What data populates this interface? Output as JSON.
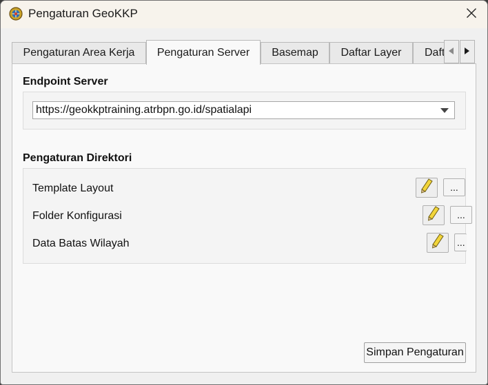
{
  "window": {
    "title": "Pengaturan GeoKKP"
  },
  "tabs": [
    {
      "label": "Pengaturan Area Kerja",
      "active": false
    },
    {
      "label": "Pengaturan Server",
      "active": true
    },
    {
      "label": "Basemap",
      "active": false
    },
    {
      "label": "Daftar Layer",
      "active": false
    },
    {
      "label": "Daftar",
      "active": false
    }
  ],
  "endpoint": {
    "heading": "Endpoint Server",
    "value": "https://geokkptraining.atrbpn.go.id/spatialapi"
  },
  "directories": {
    "heading": "Pengaturan Direktori",
    "items": [
      {
        "label": "Template Layout",
        "browse": "..."
      },
      {
        "label": "Folder Konfigurasi",
        "browse": "..."
      },
      {
        "label": "Data Batas Wilayah",
        "browse": "..."
      }
    ]
  },
  "save_label": "Simpan Pengaturan",
  "icons": {
    "app": "globe-icon",
    "close": "close-icon",
    "scroll_left": "chevron-left-icon",
    "scroll_right": "chevron-right-icon",
    "dropdown": "chevron-down-icon",
    "edit": "pencil-icon"
  },
  "colors": {
    "titlebar": "#f7f3ec",
    "panel": "#f9f9f9",
    "pencil": "#f2d53a"
  }
}
